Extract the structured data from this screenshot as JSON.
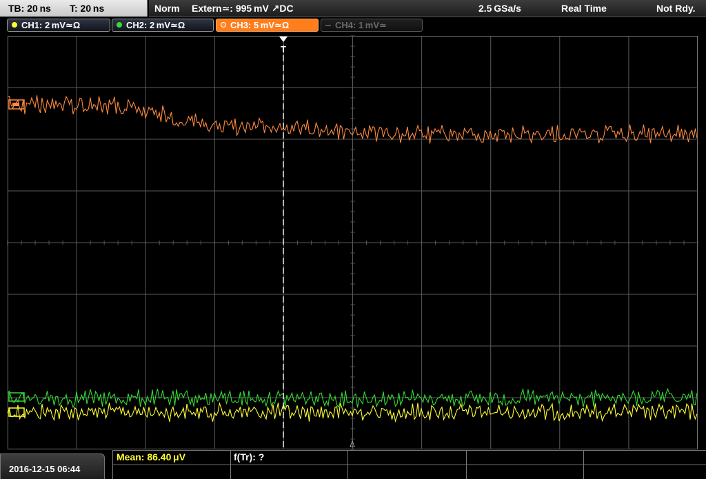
{
  "status_bar": {
    "timebase": "TB: 20 ns",
    "trigger_time": "T: 20 ns",
    "trigger_mode": "Norm",
    "trigger_source": "Extern≃: 995 mV ↗DC",
    "sample_rate": "2.5 GSa/s",
    "acquisition_mode": "Real Time",
    "run_state": "Not Rdy."
  },
  "channels": [
    {
      "label": "CH1: 2 mV≃Ω",
      "color": "#ffff33",
      "active": false,
      "enabled": true
    },
    {
      "label": "CH2: 2 mV≃Ω",
      "color": "#33dd33",
      "active": false,
      "enabled": true
    },
    {
      "label": "CH3: 5 mV≃Ω",
      "color": "#ff8a3d",
      "active": true,
      "enabled": true
    },
    {
      "label": "CH4: 1 mV≃",
      "color": "#666666",
      "active": false,
      "enabled": false
    }
  ],
  "trigger_marker": {
    "label": "T"
  },
  "footer": {
    "datetime": "2016-12-15 06:44",
    "measurement": "Mean: 86.40 μV",
    "measurement_color": "#ffff33",
    "function": "f(Tr): ?"
  },
  "colors": {
    "grid": "#5a5a5a",
    "trace_ch1": "#ffff33",
    "trace_ch2": "#33dd33",
    "trace_ch3": "#ff8a3d"
  }
}
